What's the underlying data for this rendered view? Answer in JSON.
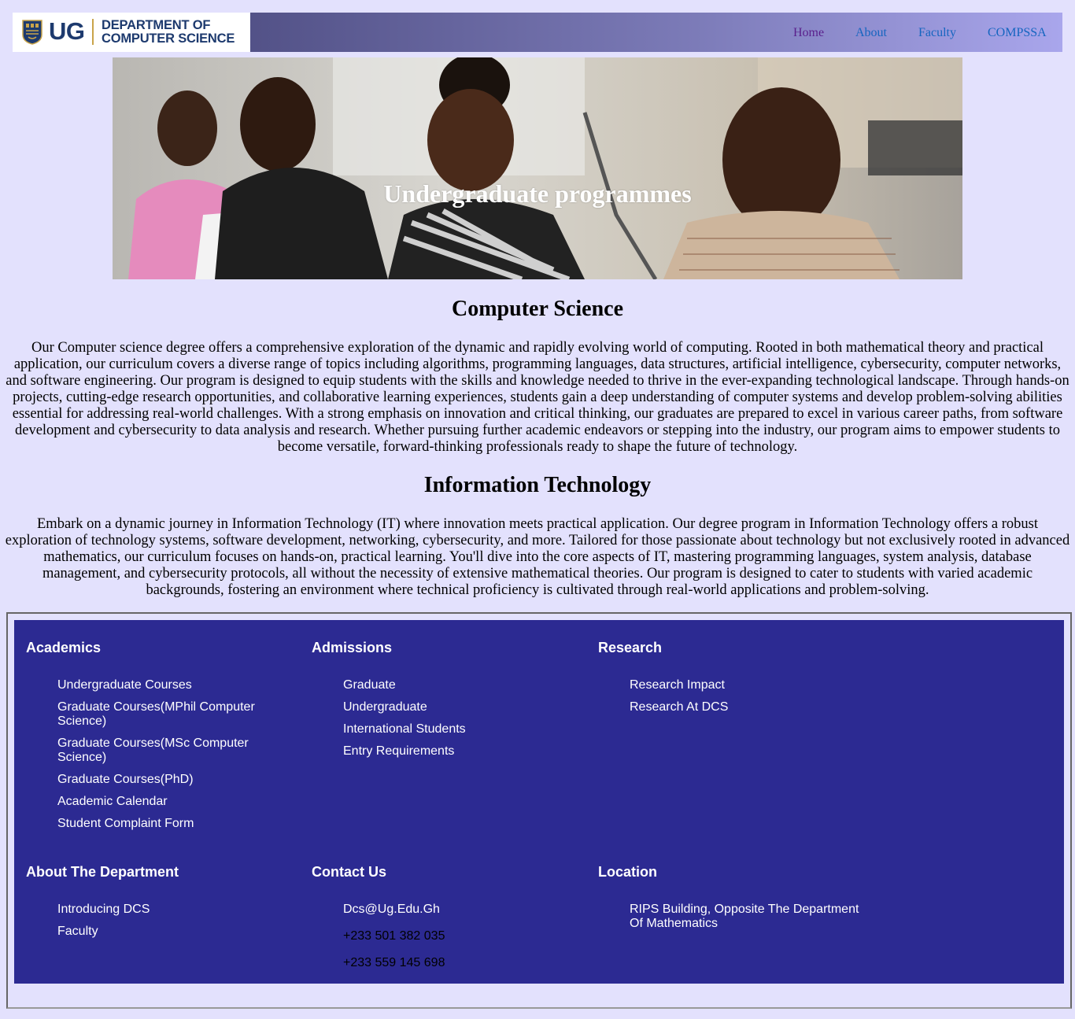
{
  "header": {
    "logo_ug": "UG",
    "logo_dept_line1": "DEPARTMENT OF",
    "logo_dept_line2": "COMPUTER SCIENCE",
    "nav": {
      "home": "Home",
      "about": "About",
      "faculty": "Faculty",
      "compssa": "COMPSSA"
    }
  },
  "hero": {
    "title": "Undergraduate programmes"
  },
  "sections": {
    "cs": {
      "title": "Computer Science",
      "body": "Our Computer science degree offers a comprehensive exploration of the dynamic and rapidly evolving world of computing. Rooted in both mathematical theory and practical application, our curriculum covers a diverse range of topics including algorithms, programming languages, data structures, artificial intelligence, cybersecurity, computer networks, and software engineering. Our program is designed to equip students with the skills and knowledge needed to thrive in the ever-expanding technological landscape. Through hands-on projects, cutting-edge research opportunities, and collaborative learning experiences, students gain a deep understanding of computer systems and develop problem-solving abilities essential for addressing real-world challenges. With a strong emphasis on innovation and critical thinking, our graduates are prepared to excel in various career paths, from software development and cybersecurity to data analysis and research. Whether pursuing further academic endeavors or stepping into the industry, our program aims to empower students to become versatile, forward-thinking professionals ready to shape the future of technology."
    },
    "it": {
      "title": "Information Technology",
      "body": "Embark on a dynamic journey in Information Technology (IT) where innovation meets practical application. Our degree program in Information Technology offers a robust exploration of technology systems, software development, networking, cybersecurity, and more. Tailored for those passionate about technology but not exclusively rooted in advanced mathematics, our curriculum focuses on hands-on, practical learning. You'll dive into the core aspects of IT, mastering programming languages, system analysis, database management, and cybersecurity protocols, all without the necessity of extensive mathematical theories. Our program is designed to cater to students with varied academic backgrounds, fostering an environment where technical proficiency is cultivated through real-world applications and problem-solving."
    }
  },
  "footer": {
    "academics": {
      "title": "Academics",
      "items": [
        "Undergraduate Courses",
        "Graduate Courses(MPhil Computer Science)",
        "Graduate Courses(MSc Computer Science)",
        "Graduate Courses(PhD)",
        "Academic Calendar",
        "Student Complaint Form"
      ]
    },
    "admissions": {
      "title": "Admissions",
      "items": [
        "Graduate",
        "Undergraduate",
        "International Students",
        "Entry Requirements"
      ]
    },
    "research": {
      "title": "Research",
      "items": [
        "Research Impact",
        "Research At DCS"
      ]
    },
    "about": {
      "title": "About The Department",
      "items": [
        "Introducing DCS",
        "Faculty"
      ]
    },
    "contact": {
      "title": "Contact Us",
      "email": "Dcs@Ug.Edu.Gh",
      "phone1": "+233 501 382 035",
      "phone2": "+233 559 145 698"
    },
    "location": {
      "title": "Location",
      "address": "RIPS Building, Opposite The Department Of Mathematics"
    }
  },
  "colors": {
    "page_bg": "#e3e1fd",
    "footer_bg": "#2c2a92",
    "link": "#1565c0",
    "visited_link": "#5a1f8c",
    "brand_navy": "#1d3a6e"
  },
  "icons": {
    "logo": "university-crest-icon"
  }
}
